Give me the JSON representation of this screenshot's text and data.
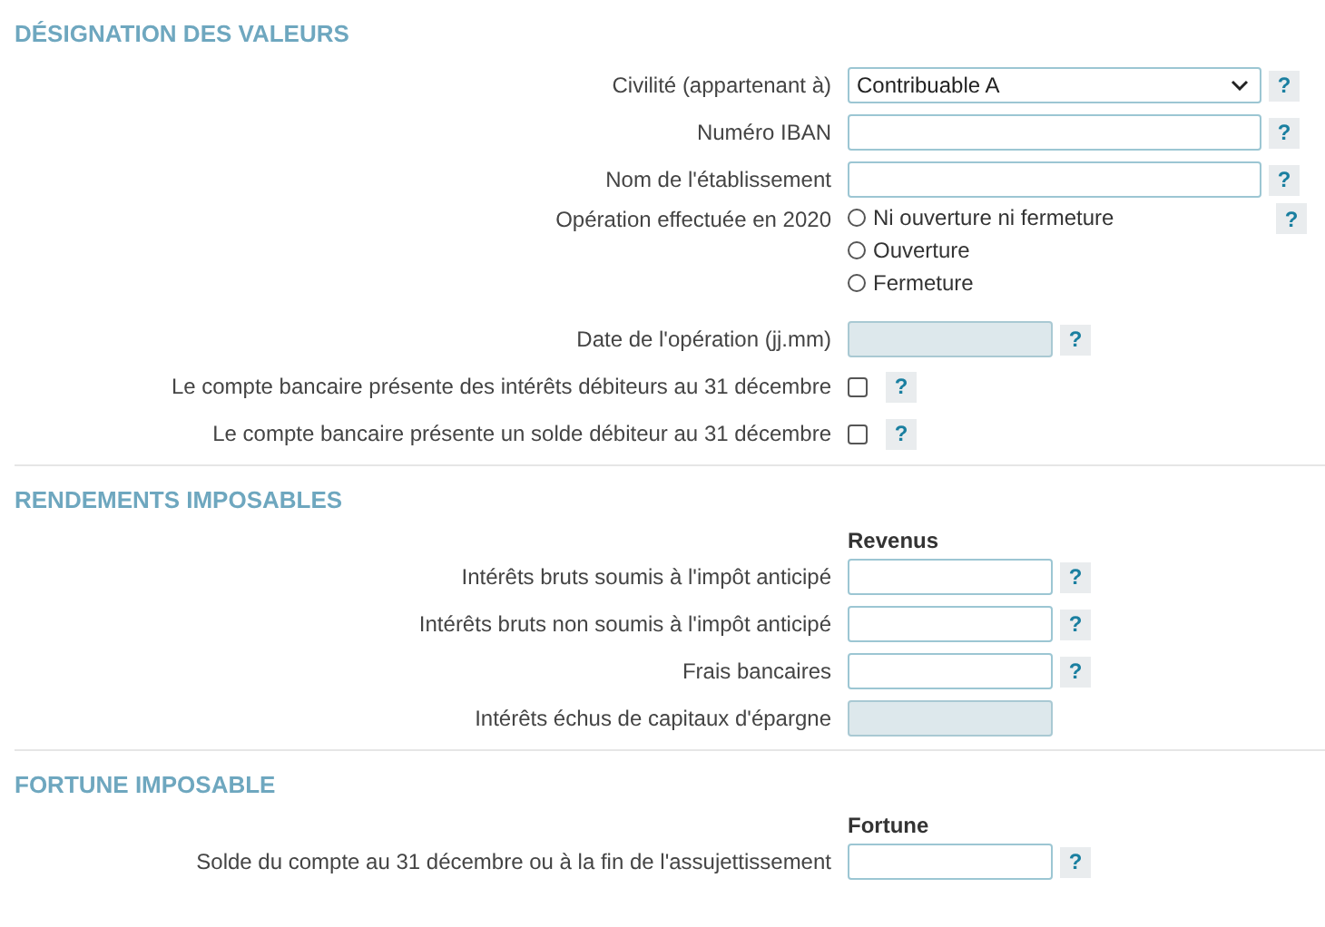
{
  "sections": [
    {
      "title": "DÉSIGNATION DES VALEURS",
      "rows": [
        {
          "kind": "select",
          "label": "Civilité (appartenant à)",
          "value": "Contribuable A",
          "help": "?"
        },
        {
          "kind": "text",
          "label": "Numéro IBAN",
          "disabled": false,
          "help": "?"
        },
        {
          "kind": "text",
          "label": "Nom de l'établissement",
          "disabled": false,
          "help": "?"
        },
        {
          "kind": "radio",
          "label": "Opération effectuée en 2020",
          "options": [
            {
              "label": "Ni ouverture ni fermeture",
              "selected": false
            },
            {
              "label": "Ouverture",
              "selected": false
            },
            {
              "label": "Fermeture",
              "selected": false
            }
          ],
          "help": "?"
        },
        {
          "kind": "short",
          "label": "Date de l'opération (jj.mm)",
          "disabled": true,
          "help": "?"
        },
        {
          "kind": "checkbox",
          "label": "Le compte bancaire présente des intérêts débiteurs au 31 décembre",
          "checked": false,
          "help": "?"
        },
        {
          "kind": "checkbox",
          "label": "Le compte bancaire présente un solde débiteur au 31 décembre",
          "checked": false,
          "help": "?"
        }
      ]
    },
    {
      "title": "RENDEMENTS IMPOSABLES",
      "column_header": "Revenus",
      "rows": [
        {
          "kind": "short",
          "label": "Intérêts bruts soumis à l'impôt anticipé",
          "disabled": false,
          "help": "?"
        },
        {
          "kind": "short",
          "label": "Intérêts bruts non soumis à l'impôt anticipé",
          "disabled": false,
          "help": "?"
        },
        {
          "kind": "short",
          "label": "Frais bancaires",
          "disabled": false,
          "help": "?"
        },
        {
          "kind": "short",
          "label": "Intérêts échus de capitaux d'épargne",
          "disabled": true
        }
      ]
    },
    {
      "title": "FORTUNE IMPOSABLE",
      "column_header": "Fortune",
      "rows": [
        {
          "kind": "short",
          "label": "Solde du compte au 31 décembre ou à la fin de l'assujettissement",
          "disabled": false,
          "help": "?"
        }
      ]
    }
  ]
}
